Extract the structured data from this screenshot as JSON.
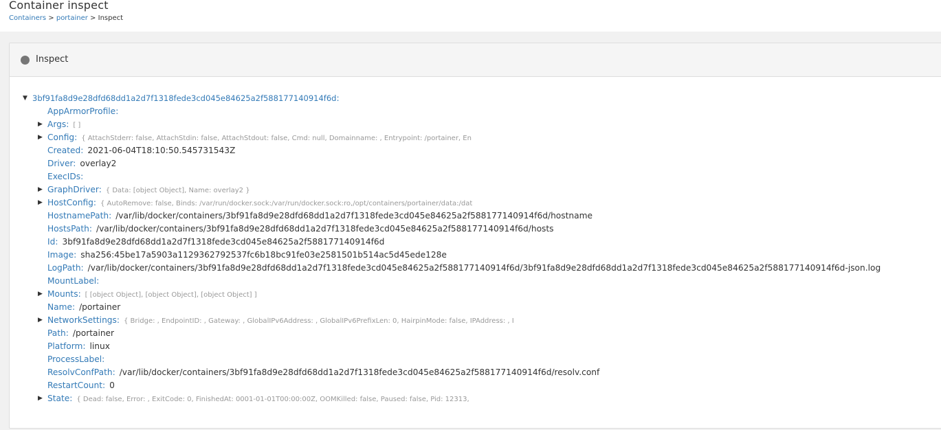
{
  "header": {
    "title": "Container inspect",
    "breadcrumb": {
      "containers": "Containers",
      "sep1": ">",
      "portainer": "portainer",
      "sep2": ">",
      "current": "Inspect"
    }
  },
  "widget": {
    "icon": "circle-icon",
    "title": "Inspect"
  },
  "tree": {
    "root_key": "3bf91fa8d9e28dfd68dd1a2d7f1318fede3cd045e84625a2f588177140914f6d",
    "items": [
      {
        "key": "AppArmorProfile",
        "value": "",
        "preview": "",
        "expandable": false
      },
      {
        "key": "Args",
        "value": "",
        "preview": "[ ]",
        "expandable": true
      },
      {
        "key": "Config",
        "value": "",
        "preview": "{ AttachStderr: false, AttachStdin: false, AttachStdout: false, Cmd: null, Domainname: , Entrypoint: /portainer, En",
        "expandable": true
      },
      {
        "key": "Created",
        "value": "2021-06-04T18:10:50.545731543Z",
        "preview": "",
        "expandable": false
      },
      {
        "key": "Driver",
        "value": "overlay2",
        "preview": "",
        "expandable": false
      },
      {
        "key": "ExecIDs",
        "value": "",
        "preview": "",
        "expandable": false
      },
      {
        "key": "GraphDriver",
        "value": "",
        "preview": "{ Data: [object Object], Name: overlay2 }",
        "expandable": true
      },
      {
        "key": "HostConfig",
        "value": "",
        "preview": "{ AutoRemove: false, Binds: /var/run/docker.sock:/var/run/docker.sock:ro,/opt/containers/portainer/data:/dat",
        "expandable": true
      },
      {
        "key": "HostnamePath",
        "value": "/var/lib/docker/containers/3bf91fa8d9e28dfd68dd1a2d7f1318fede3cd045e84625a2f588177140914f6d/hostname",
        "preview": "",
        "expandable": false
      },
      {
        "key": "HostsPath",
        "value": "/var/lib/docker/containers/3bf91fa8d9e28dfd68dd1a2d7f1318fede3cd045e84625a2f588177140914f6d/hosts",
        "preview": "",
        "expandable": false
      },
      {
        "key": "Id",
        "value": "3bf91fa8d9e28dfd68dd1a2d7f1318fede3cd045e84625a2f588177140914f6d",
        "preview": "",
        "expandable": false
      },
      {
        "key": "Image",
        "value": "sha256:45be17a5903a1129362792537fc6b18bc91fe03e2581501b514ac5d45ede128e",
        "preview": "",
        "expandable": false
      },
      {
        "key": "LogPath",
        "value": "/var/lib/docker/containers/3bf91fa8d9e28dfd68dd1a2d7f1318fede3cd045e84625a2f588177140914f6d/3bf91fa8d9e28dfd68dd1a2d7f1318fede3cd045e84625a2f588177140914f6d-json.log",
        "preview": "",
        "expandable": false
      },
      {
        "key": "MountLabel",
        "value": "",
        "preview": "",
        "expandable": false
      },
      {
        "key": "Mounts",
        "value": "",
        "preview": "[ [object Object], [object Object], [object Object] ]",
        "expandable": true
      },
      {
        "key": "Name",
        "value": "/portainer",
        "preview": "",
        "expandable": false
      },
      {
        "key": "NetworkSettings",
        "value": "",
        "preview": "{ Bridge: , EndpointID: , Gateway: , GlobalIPv6Address: , GlobalIPv6PrefixLen: 0, HairpinMode: false, IPAddress: , I",
        "expandable": true
      },
      {
        "key": "Path",
        "value": "/portainer",
        "preview": "",
        "expandable": false
      },
      {
        "key": "Platform",
        "value": "linux",
        "preview": "",
        "expandable": false
      },
      {
        "key": "ProcessLabel",
        "value": "",
        "preview": "",
        "expandable": false
      },
      {
        "key": "ResolvConfPath",
        "value": "/var/lib/docker/containers/3bf91fa8d9e28dfd68dd1a2d7f1318fede3cd045e84625a2f588177140914f6d/resolv.conf",
        "preview": "",
        "expandable": false
      },
      {
        "key": "RestartCount",
        "value": "0",
        "preview": "",
        "expandable": false
      },
      {
        "key": "State",
        "value": "",
        "preview": "{ Dead: false, Error: , ExitCode: 0, FinishedAt: 0001-01-01T00:00:00Z, OOMKilled: false, Paused: false, Pid: 12313,",
        "expandable": true
      }
    ]
  }
}
